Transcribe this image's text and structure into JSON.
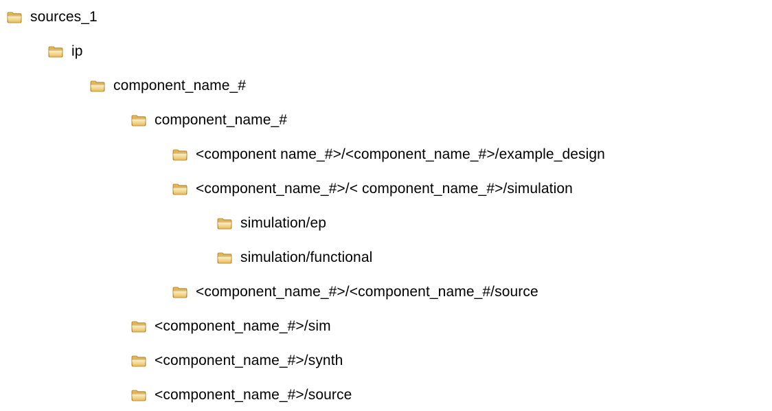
{
  "icon": "folder-icon",
  "colors": {
    "folder_back": "#d9a53a",
    "folder_front_top": "#fbecc0",
    "folder_front_bottom": "#eac46c",
    "folder_edge": "#a8791f",
    "text": "#000000"
  },
  "tree": {
    "items": [
      {
        "label": "sources_1",
        "depth": 0
      },
      {
        "label": "ip",
        "depth": 1
      },
      {
        "label": "component_name_#",
        "depth": 2
      },
      {
        "label": "component_name_#",
        "depth": 3
      },
      {
        "label": "<component name_#>/<component_name_#>/example_design",
        "depth": 4
      },
      {
        "label": "<component_name_#>/< component_name_#>/simulation",
        "depth": 4
      },
      {
        "label": "simulation/ep",
        "depth": 5
      },
      {
        "label": "simulation/functional",
        "depth": 5
      },
      {
        "label": "<component_name_#>/<component_name_#/source",
        "depth": 4
      },
      {
        "label": "<component_name_#>/sim",
        "depth": 3
      },
      {
        "label": "<component_name_#>/synth",
        "depth": 3
      },
      {
        "label": "<component_name_#>/source",
        "depth": 3
      }
    ]
  }
}
